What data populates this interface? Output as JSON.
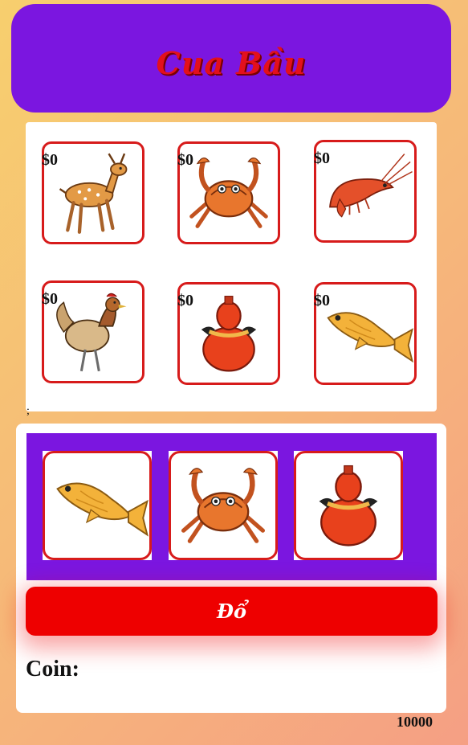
{
  "header": {
    "title": "Cua Bầu"
  },
  "board": {
    "items": [
      {
        "name": "deer",
        "bet": "$0"
      },
      {
        "name": "crab",
        "bet": "$0"
      },
      {
        "name": "shrimp",
        "bet": "$0"
      },
      {
        "name": "rooster",
        "bet": "$0"
      },
      {
        "name": "gourd",
        "bet": "$0"
      },
      {
        "name": "fish",
        "bet": "$0"
      }
    ]
  },
  "stray_text": ";",
  "result": {
    "dice": [
      "fish",
      "crab",
      "gourd"
    ]
  },
  "roll_button": {
    "label": "Đổ"
  },
  "coin": {
    "label": "Coin:",
    "value": "10000"
  }
}
